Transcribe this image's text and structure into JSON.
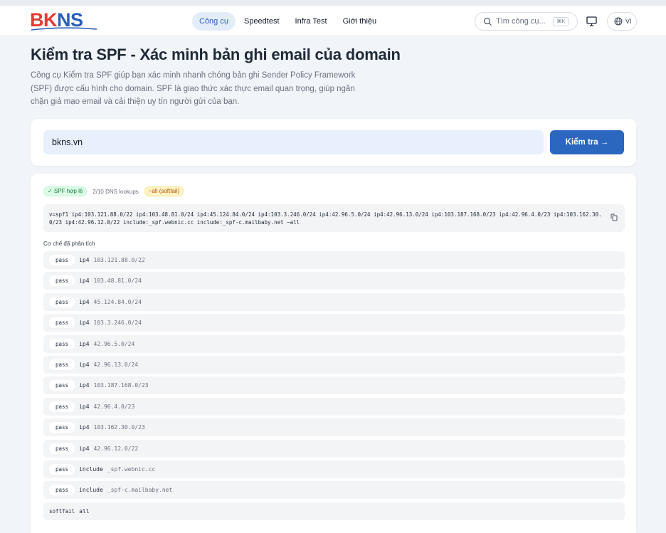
{
  "header": {
    "logo": {
      "part1": "BK",
      "part2": "NS"
    },
    "nav": [
      {
        "label": "Công cụ",
        "active": true
      },
      {
        "label": "Speedtest",
        "active": false
      },
      {
        "label": "Infra Test",
        "active": false
      },
      {
        "label": "Giới thiệu",
        "active": false
      }
    ],
    "search": {
      "placeholder": "Tìm công cụ...",
      "shortcut": "⌘K",
      "icon": "search-icon"
    },
    "display_icon": "monitor-icon",
    "language": {
      "label": "VI",
      "icon": "globe-icon"
    }
  },
  "page": {
    "title": "Kiểm tra SPF - Xác minh bản ghi email của domain",
    "intro": "Công cụ Kiểm tra SPF giúp bạn xác minh nhanh chóng bản ghi Sender Policy Framework (SPF) được cấu hình cho domain. SPF là giao thức xác thực email quan trọng, giúp ngăn chặn giả mạo email và cải thiện uy tín người gửi của bạn."
  },
  "form": {
    "domain_value": "bkns.vn",
    "submit_label": "Kiểm tra →"
  },
  "result": {
    "status_badge": "✓ SPF hợp lệ",
    "lookups": "2/10 DNS lookups",
    "all_badge": "~all (softfail)",
    "record": "v=spf1 ip4:103.121.88.0/22 ip4:103.48.81.0/24 ip4:45.124.84.0/24 ip4:103.3.246.0/24 ip4:42.96.5.0/24 ip4:42.96.13.0/24 ip4:103.187.168.0/23 ip4:42.96.4.0/23 ip4:103.162.30.0/23 ip4:42.96.12.0/22 include:_spf.webnic.cc include:_spf-c.mailbaby.net ~all",
    "mechanisms_label": "Cơ chế đã phân tích",
    "mechanisms": [
      {
        "qualifier": "pass",
        "type": "ip4",
        "value": "103.121.88.0/22"
      },
      {
        "qualifier": "pass",
        "type": "ip4",
        "value": "103.48.81.0/24"
      },
      {
        "qualifier": "pass",
        "type": "ip4",
        "value": "45.124.84.0/24"
      },
      {
        "qualifier": "pass",
        "type": "ip4",
        "value": "103.3.246.0/24"
      },
      {
        "qualifier": "pass",
        "type": "ip4",
        "value": "42.96.5.0/24"
      },
      {
        "qualifier": "pass",
        "type": "ip4",
        "value": "42.96.13.0/24"
      },
      {
        "qualifier": "pass",
        "type": "ip4",
        "value": "103.187.168.0/23"
      },
      {
        "qualifier": "pass",
        "type": "ip4",
        "value": "42.96.4.0/23"
      },
      {
        "qualifier": "pass",
        "type": "ip4",
        "value": "103.162.30.0/23"
      },
      {
        "qualifier": "pass",
        "type": "ip4",
        "value": "42.96.12.0/22"
      },
      {
        "qualifier": "pass",
        "type": "include",
        "value": "_spf.webnic.cc"
      },
      {
        "qualifier": "pass",
        "type": "include",
        "value": "_spf-c.mailbaby.net"
      },
      {
        "qualifier": "softfail",
        "type": "all",
        "value": ""
      }
    ],
    "copy_icon": "copy-icon"
  },
  "colors": {
    "accent": "#2b66bf",
    "logo_red": "#e53935",
    "logo_blue": "#2b5fb8",
    "success": "#15803d",
    "warning": "#b45309"
  }
}
